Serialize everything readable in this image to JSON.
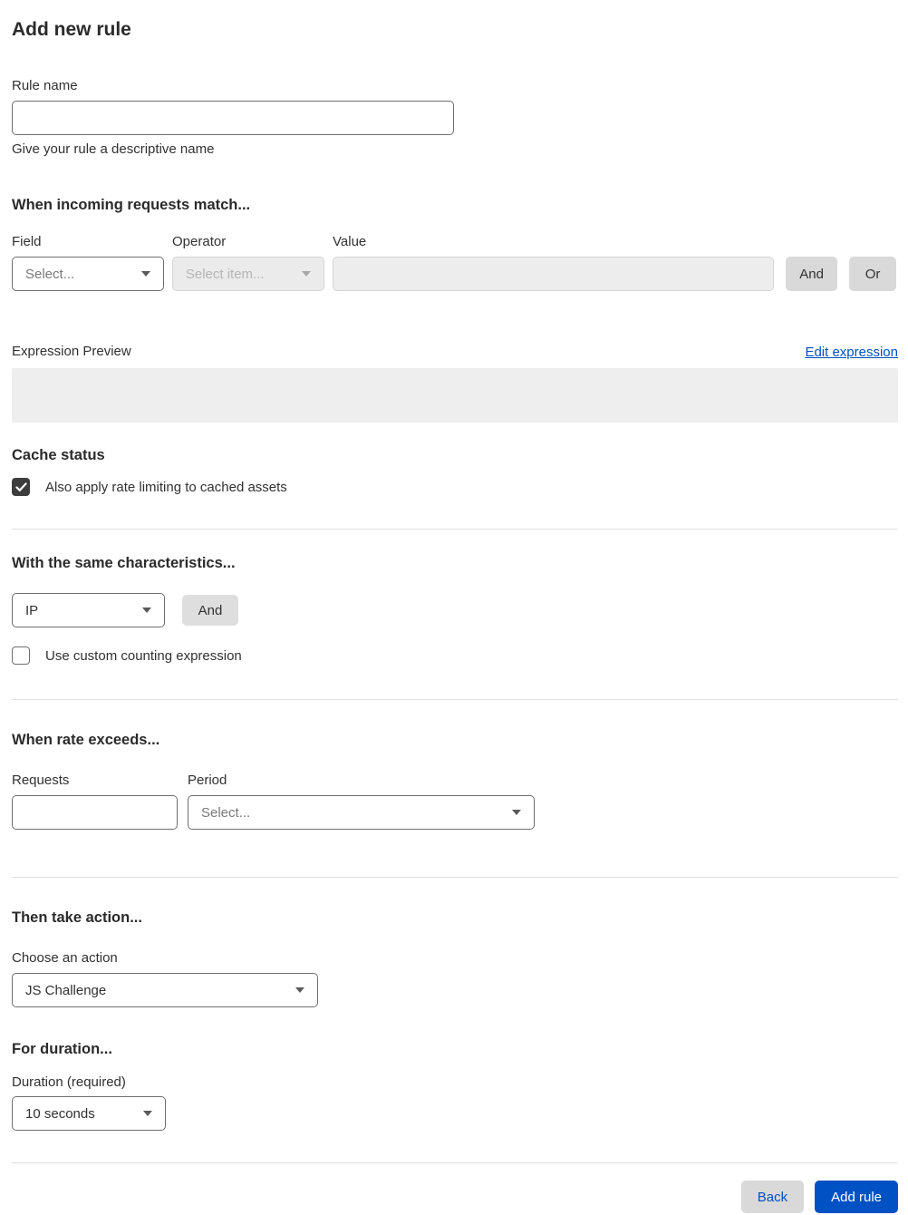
{
  "colors": {
    "accent_blue": "#0051c3",
    "text_dark": "#313131",
    "button_gray": "#d9d9d9",
    "disabled_fill": "#ededed",
    "divider": "#e0e0e0"
  },
  "page": {
    "title": "Add new rule"
  },
  "rule_name": {
    "label": "Rule name",
    "value": "",
    "helper": "Give your rule a descriptive name"
  },
  "match": {
    "heading": "When incoming requests match...",
    "field_label": "Field",
    "field_value": "Select...",
    "operator_label": "Operator",
    "operator_value": "Select item...",
    "value_label": "Value",
    "value_value": "",
    "and_label": "And",
    "or_label": "Or"
  },
  "expression": {
    "label": "Expression Preview",
    "edit_link": "Edit expression",
    "value": ""
  },
  "cache": {
    "heading": "Cache status",
    "checkbox_label": "Also apply rate limiting to cached assets",
    "checked": true
  },
  "characteristics": {
    "heading": "With the same characteristics...",
    "select_value": "IP",
    "and_label": "And",
    "checkbox_label": "Use custom counting expression",
    "checked": false
  },
  "rate": {
    "heading": "When rate exceeds...",
    "requests_label": "Requests",
    "requests_value": "",
    "period_label": "Period",
    "period_value": "Select..."
  },
  "action": {
    "heading": "Then take action...",
    "label": "Choose an action",
    "value": "JS Challenge"
  },
  "duration": {
    "heading": "For duration...",
    "label": "Duration (required)",
    "value": "10 seconds"
  },
  "footer": {
    "back_label": "Back",
    "submit_label": "Add rule"
  }
}
